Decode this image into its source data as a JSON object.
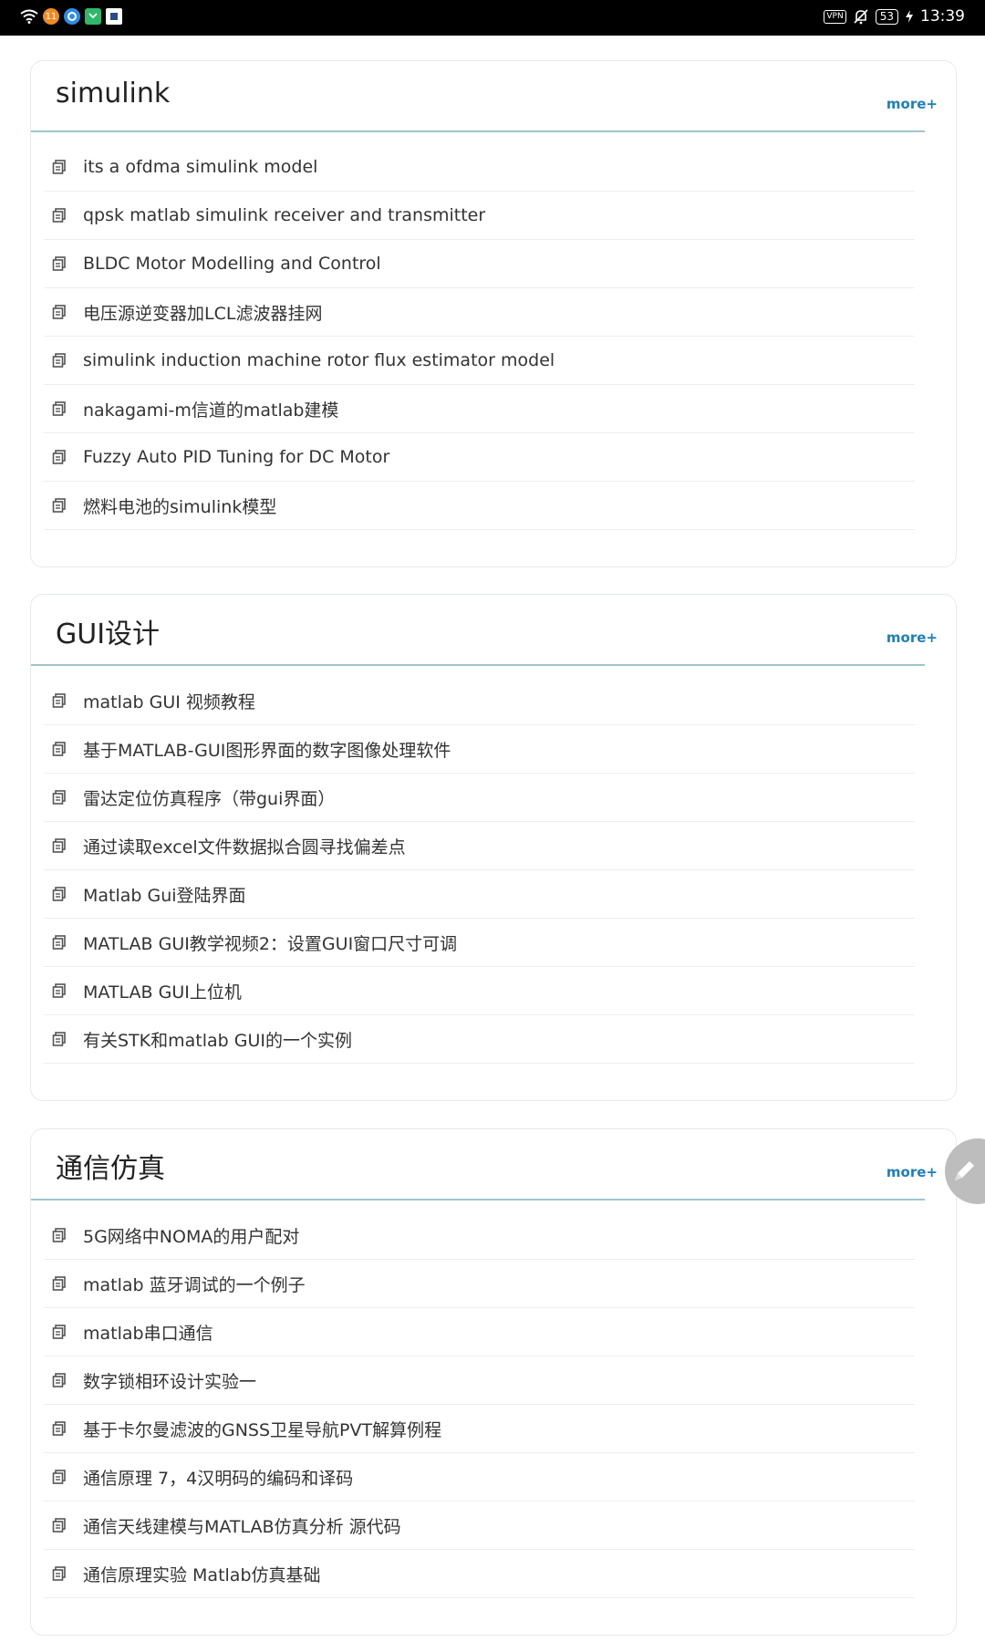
{
  "status_bar": {
    "notification_badge": "11",
    "time": "13:39",
    "battery": "53",
    "vpn_label": "VPN"
  },
  "sections": [
    {
      "title": "simulink",
      "more": "more+",
      "items": [
        "its a ofdma simulink model",
        "qpsk matlab simulink receiver and transmitter",
        "BLDC Motor Modelling and Control",
        "电压源逆变器加LCL滤波器挂网",
        "simulink induction machine rotor flux estimator model",
        "nakagami-m信道的matlab建模",
        "Fuzzy Auto PID Tuning for DC Motor",
        "燃料电池的simulink模型"
      ]
    },
    {
      "title": "GUI设计",
      "more": "more+",
      "items": [
        "matlab GUI 视频教程",
        "基于MATLAB-GUI图形界面的数字图像处理软件",
        "雷达定位仿真程序（带gui界面）",
        "通过读取excel文件数据拟合圆寻找偏差点",
        "Matlab Gui登陆界面",
        "MATLAB GUI教学视频2：设置GUI窗口尺寸可调",
        "MATLAB GUI上位机",
        "有关STK和matlab GUI的一个实例"
      ]
    },
    {
      "title": "通信仿真",
      "more": "more+",
      "items": [
        "5G网络中NOMA的用户配对",
        "matlab 蓝牙调试的一个例子",
        "matlab串口通信",
        "数字锁相环设计实验一",
        "基于卡尔曼滤波的GNSS卫星导航PVT解算例程",
        "通信原理 7，4汉明码的编码和译码",
        "通信天线建模与MATLAB仿真分析 源代码",
        "通信原理实验 Matlab仿真基础"
      ]
    }
  ],
  "colors": {
    "accent": "#1f7fb8",
    "header_rule": "#9fc4cf",
    "status_bar": "#000000",
    "fab": "#bdbdbd"
  },
  "icons": {
    "list_item": "document-icon",
    "fab": "pencil-icon"
  }
}
